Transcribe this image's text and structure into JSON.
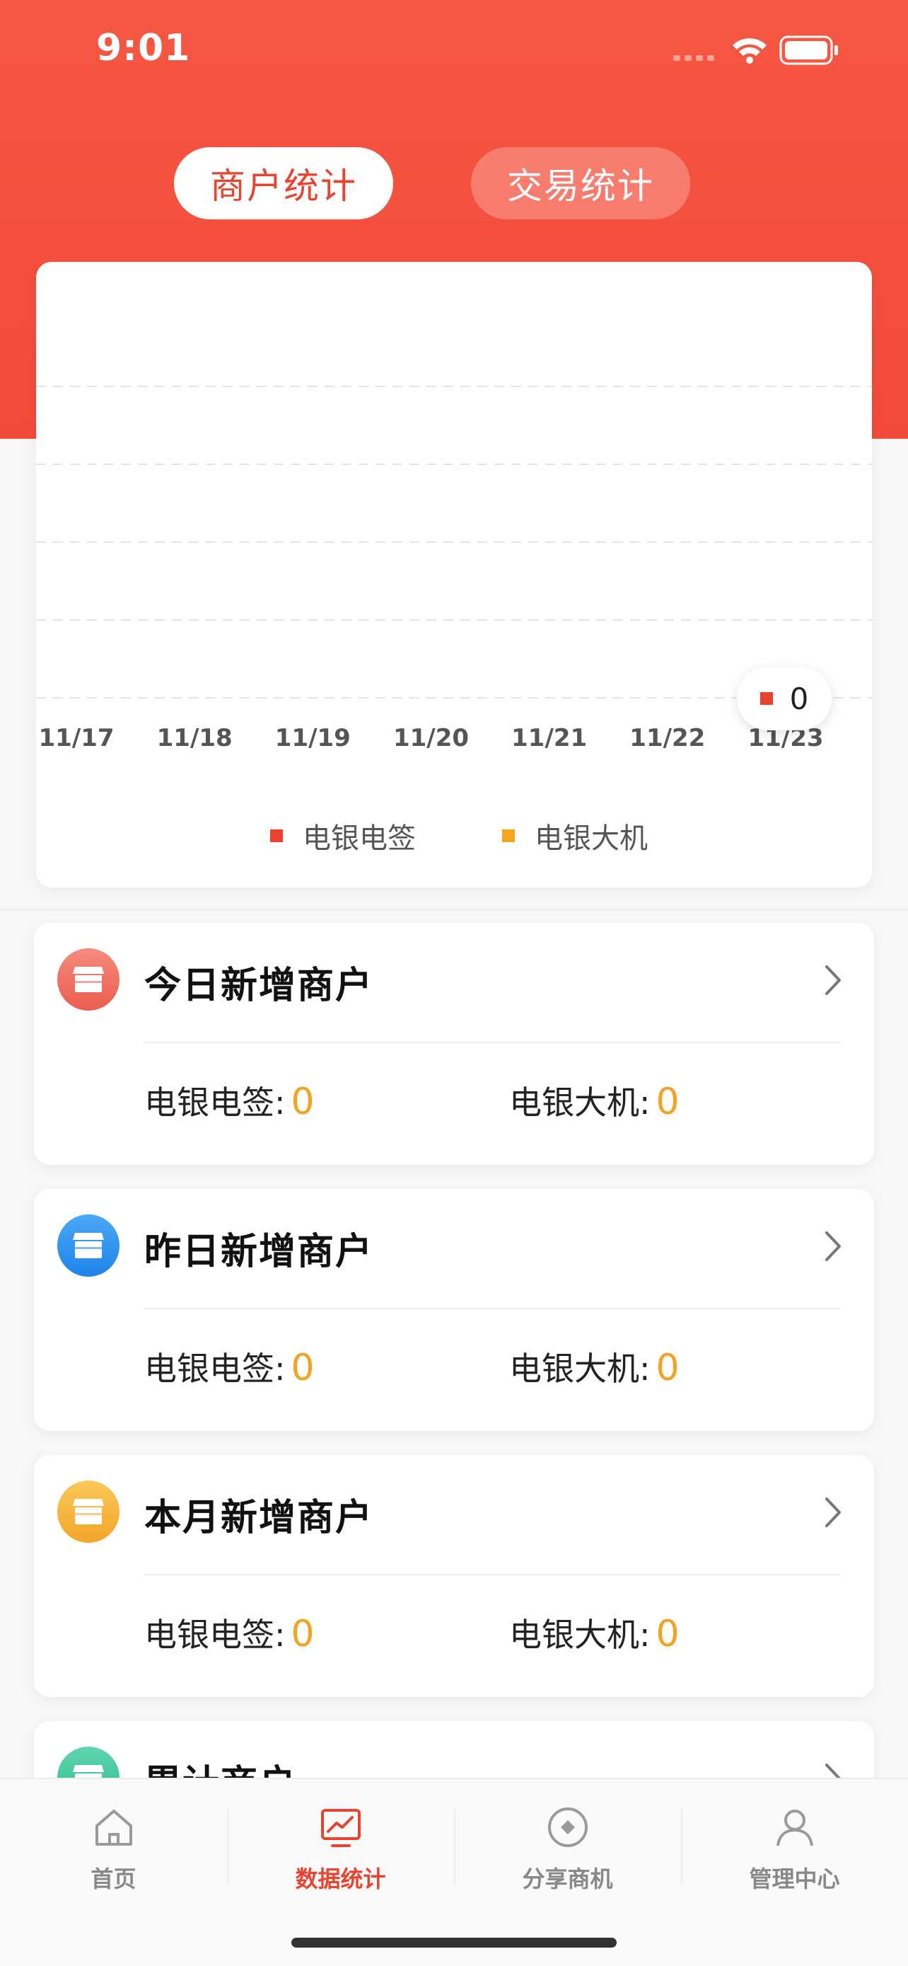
{
  "status_bar": {
    "time": "9:01"
  },
  "tabs": [
    {
      "label": "商户统计",
      "active": true
    },
    {
      "label": "交易统计",
      "active": false
    }
  ],
  "chart_data": {
    "type": "line",
    "x": [
      "11/17",
      "11/18",
      "11/19",
      "11/20",
      "11/21",
      "11/22",
      "11/23"
    ],
    "series": [
      {
        "name": "电银电签",
        "color": "#e8432f",
        "values": [
          0,
          0,
          0,
          0,
          0,
          0,
          0
        ]
      },
      {
        "name": "电银大机",
        "color": "#f4a51e",
        "values": [
          0,
          0,
          0,
          0,
          0,
          0,
          0
        ]
      }
    ],
    "ylim": [
      0,
      5
    ],
    "grid": true,
    "legend_position": "bottom",
    "tooltip_value": "0"
  },
  "stats": [
    {
      "title": "今日新增商户",
      "icon": "store-icon",
      "color": "#f07463",
      "label1": "电银电签:",
      "value1": "0",
      "label2": "电银大机:",
      "value2": "0"
    },
    {
      "title": "昨日新增商户",
      "icon": "store-icon",
      "color": "#2f95ef",
      "label1": "电银电签:",
      "value1": "0",
      "label2": "电银大机:",
      "value2": "0"
    },
    {
      "title": "本月新增商户",
      "icon": "store-icon",
      "color": "#f6b53a",
      "label1": "电银电签:",
      "value1": "0",
      "label2": "电银大机:",
      "value2": "0"
    },
    {
      "title": "累计商户",
      "icon": "store-icon",
      "color": "#3ec39b"
    }
  ],
  "tabbar": [
    {
      "label": "首页",
      "icon": "home-icon",
      "active": false
    },
    {
      "label": "数据统计",
      "icon": "chart-icon",
      "active": true
    },
    {
      "label": "分享商机",
      "icon": "share-icon",
      "active": false
    },
    {
      "label": "管理中心",
      "icon": "user-icon",
      "active": false
    }
  ]
}
